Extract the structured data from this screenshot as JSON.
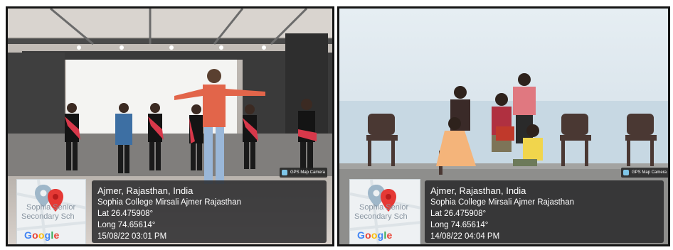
{
  "photos": [
    {
      "location": "Ajmer, Rajasthan, India",
      "address": "Sophia College Mirsali Ajmer Rajasthan",
      "lat": "Lat 26.475908°",
      "long": "Long 74.65614°",
      "datetime": "15/08/22 03:01 PM",
      "map_place": "Sophia Senior Secondary Sch",
      "map_place_line1": "Sophia Senior",
      "map_place_line2": "Secondary Sch",
      "map_brand": "Google",
      "camera_badge": "GPS Map Camera"
    },
    {
      "location": "Ajmer, Rajasthan, India",
      "address": "Sophia College Mirsali Ajmer Rajasthan",
      "lat": "Lat 26.475908°",
      "long": "Long 74.65614°",
      "datetime": "14/08/22 04:04 PM",
      "map_place_line1": "Sophia Senior",
      "map_place_line2": "Secondary Sch",
      "map_brand": "Google",
      "camera_badge": "GPS Map Camera"
    }
  ],
  "colors": {
    "frame": "#151515",
    "overlay": "#262628",
    "pin": "#e53935",
    "stage_wall": "#6e6e6e",
    "sky": "#dfeaf2"
  },
  "icons": [
    "map-pin-icon",
    "location-marker-icon",
    "gps-camera-icon"
  ]
}
